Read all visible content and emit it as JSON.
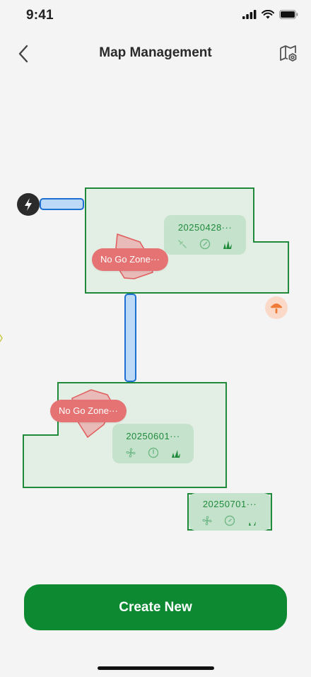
{
  "status_bar": {
    "time": "9:41"
  },
  "header": {
    "title": "Map Management"
  },
  "map": {
    "no_go_zones": [
      {
        "label": "No Go Zone···"
      },
      {
        "label": "No Go Zone···"
      }
    ],
    "areas": [
      {
        "name": "20250428···"
      },
      {
        "name": "20250601···"
      },
      {
        "name": "20250701···"
      }
    ]
  },
  "footer": {
    "create_label": "Create New"
  },
  "colors": {
    "accent": "#0d8a31",
    "area_fill": "#e3efe5",
    "area_border": "#1f8a3a",
    "no_go_fill": "#e57373",
    "path_fill": "#bcd9f7",
    "path_border": "#1d6fd1"
  },
  "icons": {
    "back": "chevron-left-icon",
    "settings": "map-settings-icon",
    "station": "charging-station-icon",
    "marker": "mushroom-marker-icon",
    "area_icons": [
      "fan-icon",
      "compass-icon",
      "grass-icon"
    ]
  }
}
